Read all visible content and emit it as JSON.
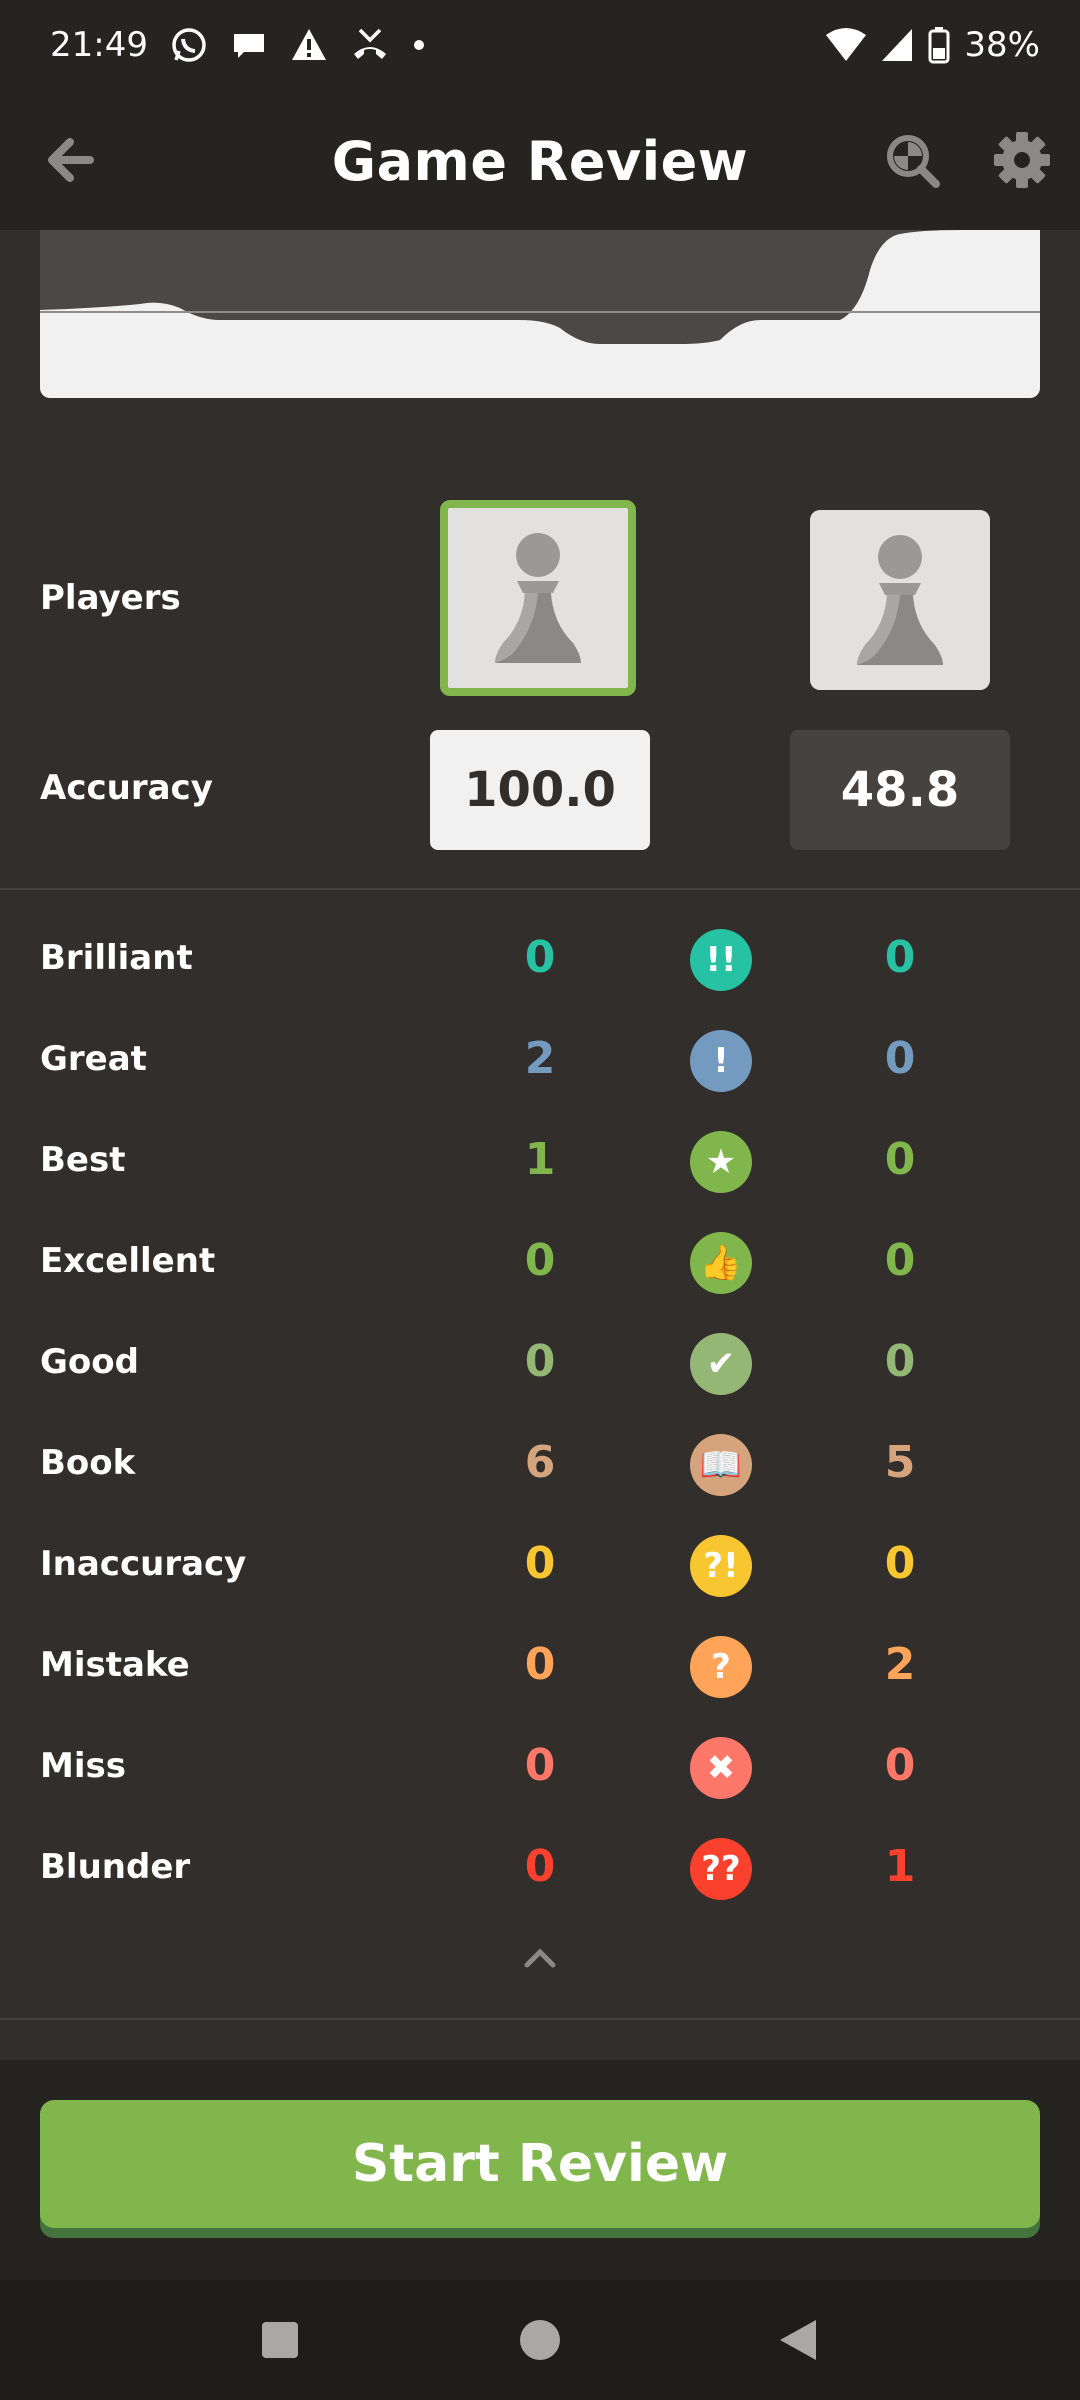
{
  "status_bar": {
    "time": "21:49",
    "battery": "38%",
    "icons": [
      "whatsapp-icon",
      "chat-bubble-icon",
      "warning-icon",
      "missed-call-icon",
      "dot-icon",
      "wifi-icon",
      "signal-icon",
      "battery-icon"
    ]
  },
  "app_bar": {
    "title": "Game Review",
    "icons": [
      "back-arrow-icon",
      "analysis-icon",
      "gear-icon"
    ]
  },
  "players": {
    "label": "Players"
  },
  "accuracy": {
    "label": "Accuracy",
    "white": "100.0",
    "black": "48.8"
  },
  "moves": [
    {
      "name": "Brilliant",
      "white": "0",
      "black": "0",
      "symbol": "!!",
      "color": "#26c2a3",
      "icon": "brilliant-icon"
    },
    {
      "name": "Great",
      "white": "2",
      "black": "0",
      "symbol": "!",
      "color": "#749bbf",
      "icon": "great-icon"
    },
    {
      "name": "Best",
      "white": "1",
      "black": "0",
      "symbol": "★",
      "color": "#81b64c",
      "icon": "best-star-icon"
    },
    {
      "name": "Excellent",
      "white": "0",
      "black": "0",
      "symbol": "👍",
      "color": "#81b64c",
      "icon": "excellent-thumbs-up-icon"
    },
    {
      "name": "Good",
      "white": "0",
      "black": "0",
      "symbol": "✔",
      "color": "#95b776",
      "icon": "good-check-icon"
    },
    {
      "name": "Book",
      "white": "6",
      "black": "5",
      "symbol": "📖",
      "color": "#d5a47d",
      "icon": "book-icon"
    },
    {
      "name": "Inaccuracy",
      "white": "0",
      "black": "0",
      "symbol": "?!",
      "color": "#f7c631",
      "icon": "inaccuracy-icon"
    },
    {
      "name": "Mistake",
      "white": "0",
      "black": "2",
      "symbol": "?",
      "color": "#ffa459",
      "icon": "mistake-icon"
    },
    {
      "name": "Miss",
      "white": "0",
      "black": "0",
      "symbol": "✖",
      "color": "#ff7769",
      "icon": "miss-x-icon"
    },
    {
      "name": "Blunder",
      "white": "0",
      "black": "1",
      "symbol": "??",
      "color": "#fa412d",
      "icon": "blunder-icon"
    }
  ],
  "start_button": "Start Review",
  "nav_icons": [
    "recents-square-icon",
    "home-circle-icon",
    "back-triangle-icon"
  ]
}
